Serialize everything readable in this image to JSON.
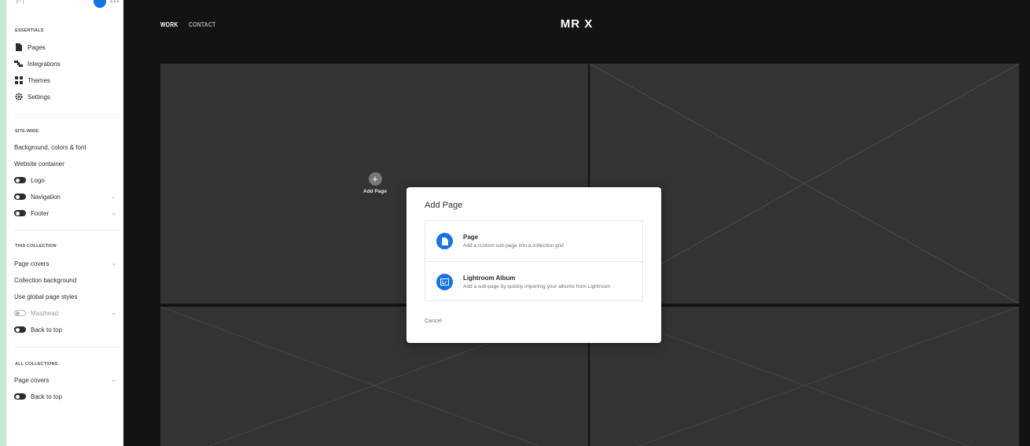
{
  "sidebar": {
    "logo": "Pf",
    "more": "•••",
    "sections": {
      "essentials": "ESSENTIALS",
      "site_wide": "SITE-WIDE",
      "this_collection": "THIS COLLECTION",
      "all_collections": "ALL COLLECTIONS"
    },
    "essentials": [
      "Pages",
      "Integrations",
      "Themes",
      "Settings"
    ],
    "site_wide": [
      "Background, colors & font",
      "Website container",
      "Logo",
      "Navigation",
      "Footer"
    ],
    "this_collection": [
      "Page covers",
      "Collection background",
      "Use global page styles",
      "Masthead",
      "Back to top"
    ],
    "all_collections": [
      "Page covers",
      "Back to top"
    ]
  },
  "site": {
    "nav": [
      "WORK",
      "CONTACT"
    ],
    "title": "MR X",
    "add_page_label": "Add Page"
  },
  "modal": {
    "title": "Add Page",
    "options": [
      {
        "title": "Page",
        "desc": "Add a custom sub-page into a collection grid",
        "icon": "page-icon"
      },
      {
        "title": "Lightroom Album",
        "desc": "Add a sub-page by quickly importing your albums from Lightroom",
        "icon": "lightroom-icon"
      }
    ],
    "cancel": "Cancel"
  },
  "colors": {
    "accent": "#1473e6",
    "canvas": "#131313",
    "tile": "#333333",
    "backdrop": "#c8e8d4"
  }
}
